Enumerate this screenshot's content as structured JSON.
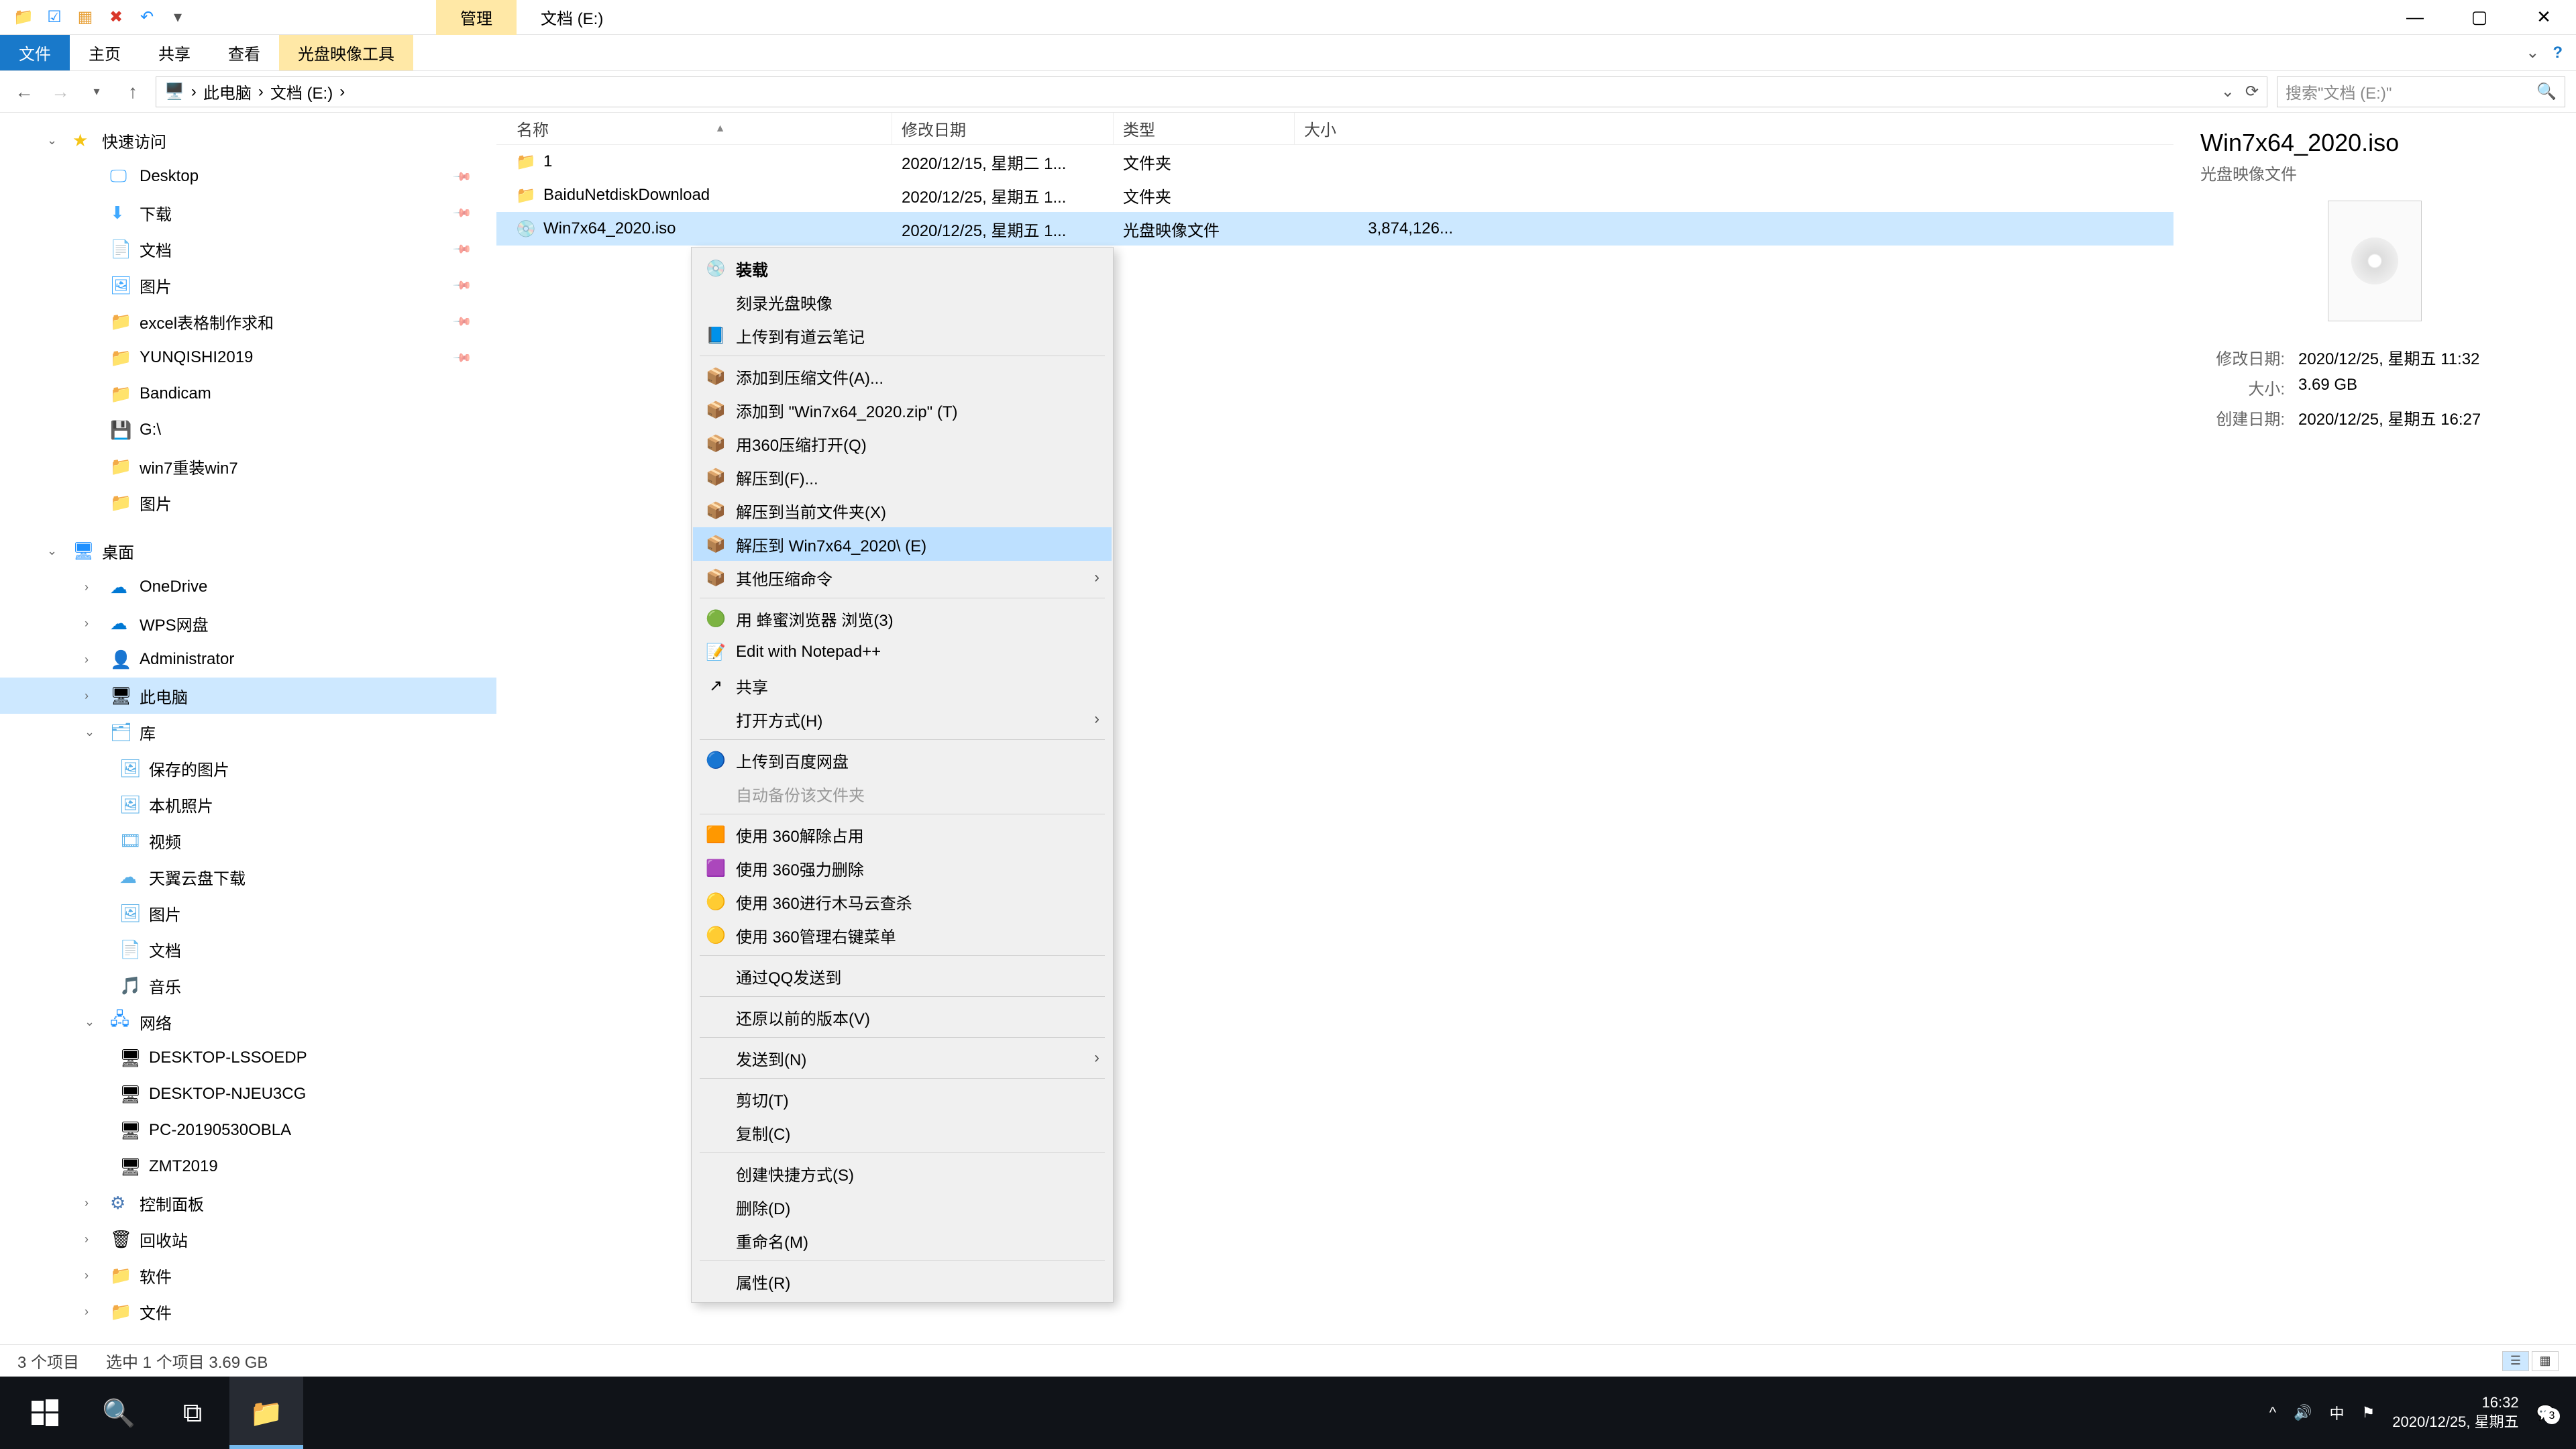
{
  "window": {
    "title_tab_manage": "管理",
    "title_tab_location": "文档 (E:)",
    "ribbon": {
      "file": "文件",
      "home": "主页",
      "share": "共享",
      "view": "查看",
      "disc_tool": "光盘映像工具"
    }
  },
  "nav_btns": {
    "back": "←",
    "forward": "→",
    "up": "↑"
  },
  "address": {
    "root": "此电脑",
    "drive": "文档 (E:)"
  },
  "search": {
    "placeholder": "搜索\"文档 (E:)\""
  },
  "tree": {
    "quick": "快速访问",
    "q_items": [
      "Desktop",
      "下载",
      "文档",
      "图片",
      "excel表格制作求和",
      "YUNQISHI2019",
      "Bandicam",
      "G:\\",
      "win7重装win7",
      "图片"
    ],
    "desktop": "桌面",
    "d_items": [
      "OneDrive",
      "WPS网盘",
      "Administrator",
      "此电脑",
      "库"
    ],
    "lib_items": [
      "保存的图片",
      "本机照片",
      "视频",
      "天翼云盘下载",
      "图片",
      "文档",
      "音乐"
    ],
    "network": "网络",
    "net_items": [
      "DESKTOP-LSSOEDP",
      "DESKTOP-NJEU3CG",
      "PC-20190530OBLA",
      "ZMT2019"
    ],
    "others": [
      "控制面板",
      "回收站",
      "软件",
      "文件"
    ]
  },
  "columns": {
    "name": "名称",
    "date": "修改日期",
    "type": "类型",
    "size": "大小"
  },
  "files": [
    {
      "name": "1",
      "date": "2020/12/15, 星期二 1...",
      "type": "文件夹",
      "size": ""
    },
    {
      "name": "BaiduNetdiskDownload",
      "date": "2020/12/25, 星期五 1...",
      "type": "文件夹",
      "size": ""
    },
    {
      "name": "Win7x64_2020.iso",
      "date": "2020/12/25, 星期五 1...",
      "type": "光盘映像文件",
      "size": "3,874,126..."
    }
  ],
  "context": [
    {
      "t": "装载",
      "ic": "💿",
      "bold": true
    },
    {
      "t": "刻录光盘映像"
    },
    {
      "t": "上传到有道云笔记",
      "ic": "📘"
    },
    {
      "sep": true
    },
    {
      "t": "添加到压缩文件(A)...",
      "ic": "📦"
    },
    {
      "t": "添加到 \"Win7x64_2020.zip\" (T)",
      "ic": "📦"
    },
    {
      "t": "用360压缩打开(Q)",
      "ic": "📦"
    },
    {
      "t": "解压到(F)...",
      "ic": "📦"
    },
    {
      "t": "解压到当前文件夹(X)",
      "ic": "📦"
    },
    {
      "t": "解压到 Win7x64_2020\\ (E)",
      "ic": "📦",
      "hover": true
    },
    {
      "t": "其他压缩命令",
      "ic": "📦",
      "sub": true
    },
    {
      "sep": true
    },
    {
      "t": "用 蜂蜜浏览器 浏览(3)",
      "ic": "🟢"
    },
    {
      "t": "Edit with Notepad++",
      "ic": "📝"
    },
    {
      "t": "共享",
      "ic": "↗"
    },
    {
      "t": "打开方式(H)",
      "sub": true
    },
    {
      "sep": true
    },
    {
      "t": "上传到百度网盘",
      "ic": "🔵"
    },
    {
      "t": "自动备份该文件夹",
      "disabled": true
    },
    {
      "sep": true
    },
    {
      "t": "使用 360解除占用",
      "ic": "🟧"
    },
    {
      "t": "使用 360强力删除",
      "ic": "🟪"
    },
    {
      "t": "使用 360进行木马云查杀",
      "ic": "🟡"
    },
    {
      "t": "使用 360管理右键菜单",
      "ic": "🟡"
    },
    {
      "sep": true
    },
    {
      "t": "通过QQ发送到"
    },
    {
      "sep": true
    },
    {
      "t": "还原以前的版本(V)"
    },
    {
      "sep": true
    },
    {
      "t": "发送到(N)",
      "sub": true
    },
    {
      "sep": true
    },
    {
      "t": "剪切(T)"
    },
    {
      "t": "复制(C)"
    },
    {
      "sep": true
    },
    {
      "t": "创建快捷方式(S)"
    },
    {
      "t": "删除(D)"
    },
    {
      "t": "重命名(M)"
    },
    {
      "sep": true
    },
    {
      "t": "属性(R)"
    }
  ],
  "details": {
    "name": "Win7x64_2020.iso",
    "type": "光盘映像文件",
    "mdate_k": "修改日期:",
    "mdate_v": "2020/12/25, 星期五 11:32",
    "size_k": "大小:",
    "size_v": "3.69 GB",
    "cdate_k": "创建日期:",
    "cdate_v": "2020/12/25, 星期五 16:27"
  },
  "status": {
    "count": "3 个项目",
    "sel": "选中 1 个项目  3.69 GB"
  },
  "taskbar": {
    "ime": "中",
    "time": "16:32",
    "date": "2020/12/25, 星期五",
    "notif": "3"
  }
}
